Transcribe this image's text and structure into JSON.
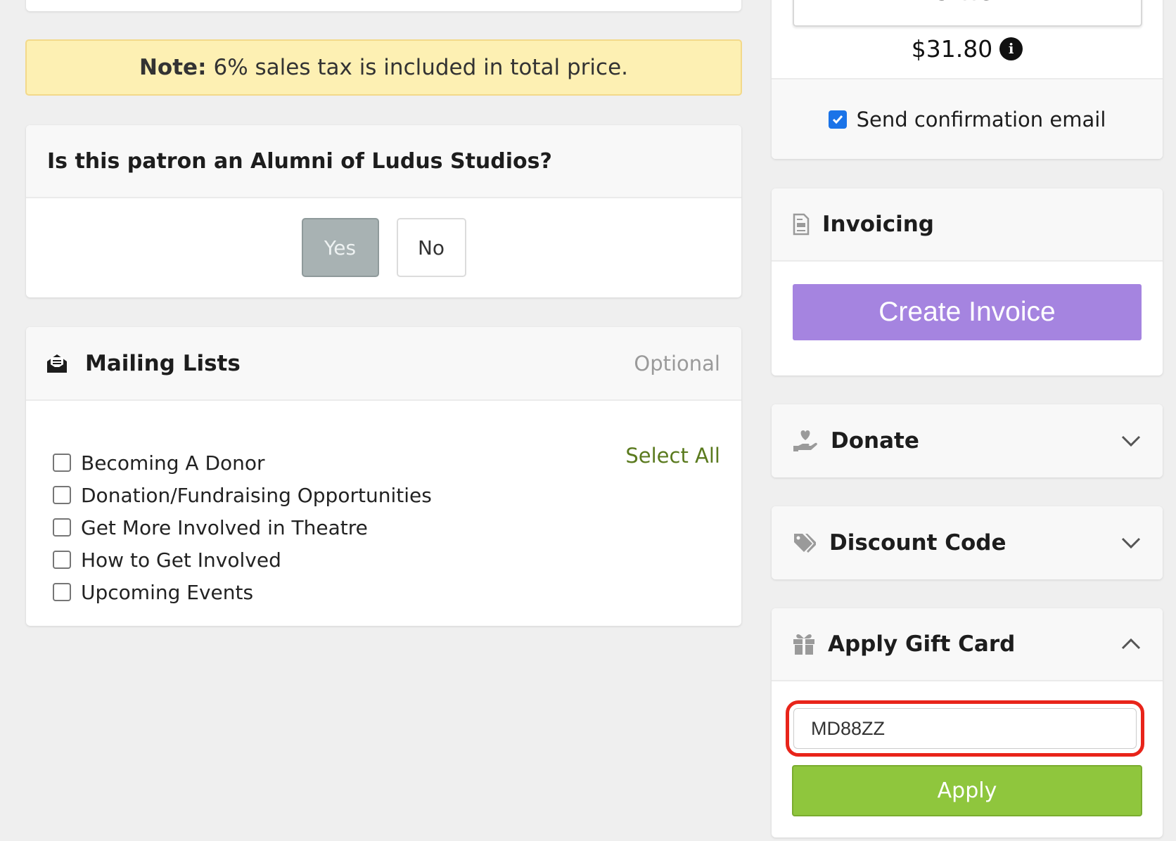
{
  "note": {
    "label": "Note:",
    "text": "6% sales tax is included in total price."
  },
  "alumni": {
    "question": "Is this patron an Alumni of Ludus Studios?",
    "yes_label": "Yes",
    "no_label": "No"
  },
  "mailing": {
    "title": "Mailing Lists",
    "optional_label": "Optional",
    "select_all_label": "Select All",
    "items": [
      {
        "label": "Becoming A Donor",
        "checked": false
      },
      {
        "label": "Donation/Fundraising Opportunities",
        "checked": false
      },
      {
        "label": "Get More Involved in Theatre",
        "checked": false
      },
      {
        "label": "How to Get Involved",
        "checked": false
      },
      {
        "label": "Upcoming Events",
        "checked": false
      }
    ]
  },
  "price": {
    "other_label": "Other",
    "amount": "$31.80",
    "info_icon": "info-icon",
    "confirm_label": "Send confirmation email",
    "confirm_checked": true
  },
  "invoicing": {
    "title": "Invoicing",
    "create_label": "Create Invoice",
    "accent": "#a584e0"
  },
  "donate": {
    "title": "Donate"
  },
  "discount": {
    "title": "Discount Code"
  },
  "giftcard": {
    "title": "Apply Gift Card",
    "input_value": "MD88ZZ",
    "apply_label": "Apply",
    "accent": "#8fc63d",
    "highlight": "#e8241a"
  }
}
